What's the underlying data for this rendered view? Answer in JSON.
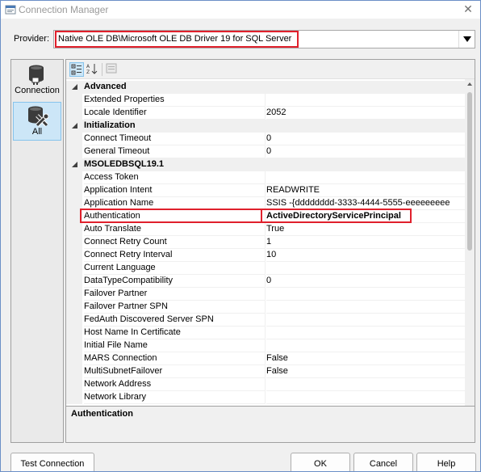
{
  "window": {
    "title": "Connection Manager",
    "close_glyph": "✕"
  },
  "provider": {
    "label": "Provider:",
    "value": "Native OLE DB\\Microsoft OLE DB Driver 19 for SQL Server"
  },
  "nav": [
    {
      "label": "Connection",
      "icon": "database-plug-icon"
    },
    {
      "label": "All",
      "icon": "database-tools-icon"
    }
  ],
  "toolbar": [
    "categorized-icon",
    "alphabetical-icon",
    "property-pages-icon"
  ],
  "grid": {
    "categories": [
      {
        "name": "Advanced",
        "properties": [
          {
            "name": "Extended Properties",
            "value": ""
          },
          {
            "name": "Locale Identifier",
            "value": "2052"
          }
        ]
      },
      {
        "name": "Initialization",
        "properties": [
          {
            "name": "Connect Timeout",
            "value": "0"
          },
          {
            "name": "General Timeout",
            "value": "0"
          }
        ]
      },
      {
        "name": "MSOLEDBSQL19.1",
        "properties": [
          {
            "name": "Access Token",
            "value": ""
          },
          {
            "name": "Application Intent",
            "value": "READWRITE"
          },
          {
            "name": "Application Name",
            "value": "SSIS -{dddddddd-3333-4444-5555-eeeeeeeee"
          },
          {
            "name": "Authentication",
            "value": "ActiveDirectoryServicePrincipal",
            "bold": true
          },
          {
            "name": "Auto Translate",
            "value": "True"
          },
          {
            "name": "Connect Retry Count",
            "value": "1"
          },
          {
            "name": "Connect Retry Interval",
            "value": "10"
          },
          {
            "name": "Current Language",
            "value": ""
          },
          {
            "name": "DataTypeCompatibility",
            "value": "0"
          },
          {
            "name": "Failover Partner",
            "value": ""
          },
          {
            "name": "Failover Partner SPN",
            "value": ""
          },
          {
            "name": "FedAuth Discovered Server SPN",
            "value": ""
          },
          {
            "name": "Host Name In Certificate",
            "value": ""
          },
          {
            "name": "Initial File Name",
            "value": ""
          },
          {
            "name": "MARS Connection",
            "value": "False"
          },
          {
            "name": "MultiSubnetFailover",
            "value": "False"
          },
          {
            "name": "Network Address",
            "value": ""
          },
          {
            "name": "Network Library",
            "value": ""
          }
        ]
      }
    ]
  },
  "description": {
    "title": "Authentication"
  },
  "buttons": {
    "test_connection": "Test Connection",
    "ok": "OK",
    "cancel": "Cancel",
    "help": "Help"
  },
  "colors": {
    "highlight": "#e0202c",
    "selection": "#cce6f7",
    "category_bg": "#f0f0f0"
  }
}
